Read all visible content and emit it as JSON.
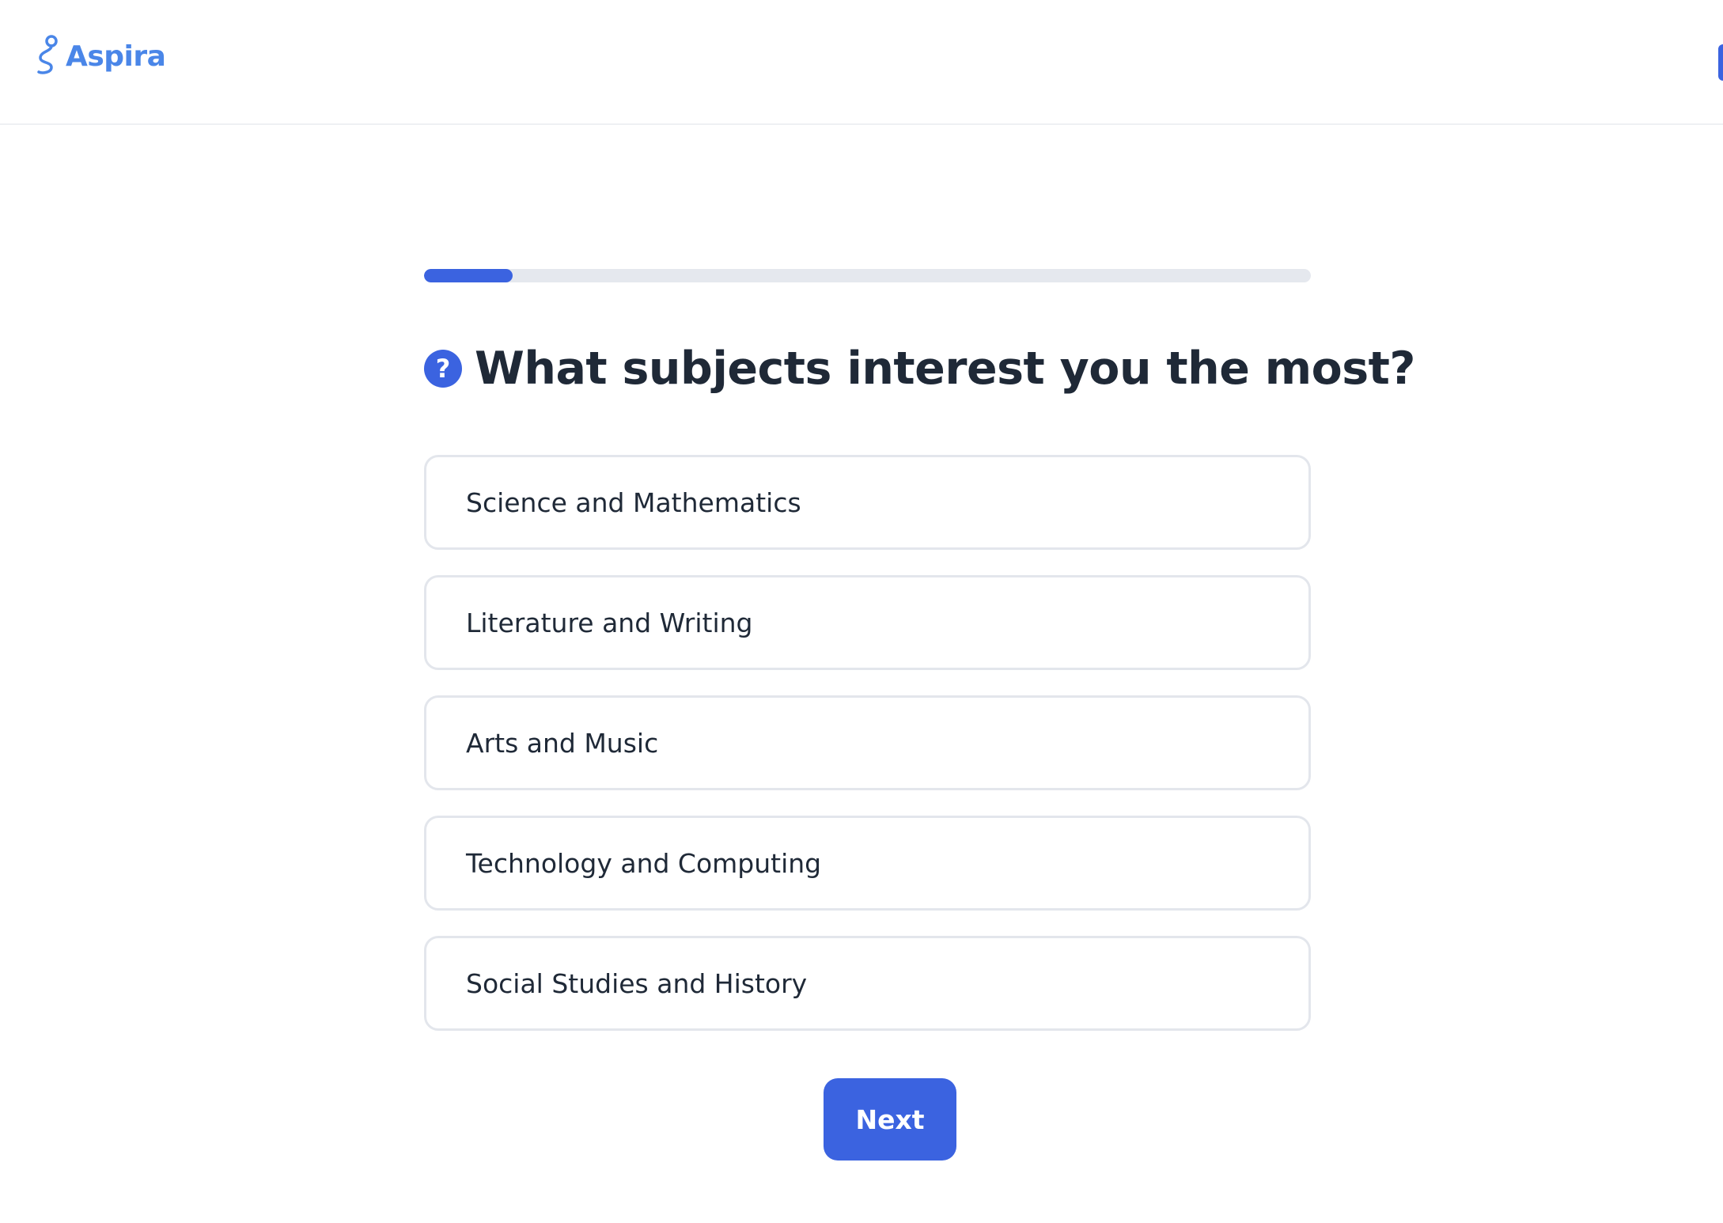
{
  "header": {
    "brand": "Aspira",
    "logo_icon": "route-pin-icon",
    "accent_color": "#4a86e8"
  },
  "progress": {
    "fraction": 0.1,
    "color": "#3b63e0"
  },
  "question": {
    "icon": "question-circle-icon",
    "text": "What subjects interest you the most?"
  },
  "options": [
    {
      "label": "Science and Mathematics"
    },
    {
      "label": "Literature and Writing"
    },
    {
      "label": "Arts and Music"
    },
    {
      "label": "Technology and Computing"
    },
    {
      "label": "Social Studies and History"
    }
  ],
  "actions": {
    "next_label": "Next"
  },
  "colors": {
    "primary": "#3b63e0",
    "text": "#1f2937",
    "border": "#e3e6ec"
  }
}
